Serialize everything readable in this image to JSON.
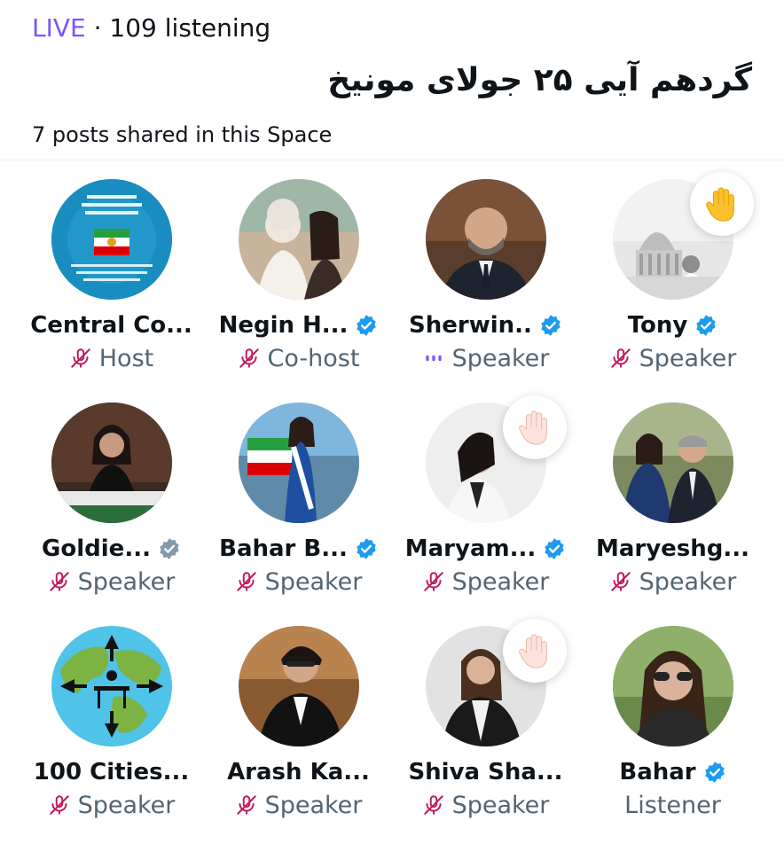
{
  "header": {
    "live_label": "LIVE",
    "separator": "·",
    "listening": "109 listening",
    "title": "گردهم آیی ۲۵ جولای مونیخ",
    "posts_shared": "7 posts shared in this Space"
  },
  "colors": {
    "accent_purple": "#7856ff",
    "muted_pink": "#c2185b",
    "verified_blue": "#1d9bf0",
    "verified_gray": "#829aab",
    "secondary_text": "#536471"
  },
  "participants": [
    {
      "name": "Central Co...",
      "role": "Host",
      "verified": "none",
      "icon": "mic-off-icon"
    },
    {
      "name": "Negin H...",
      "role": "Co-host",
      "verified": "blue",
      "icon": "mic-off-icon"
    },
    {
      "name": "Sherwin..",
      "role": "Speaker",
      "verified": "blue",
      "icon": "speaking-dots-icon"
    },
    {
      "name": "Tony",
      "role": "Speaker",
      "verified": "blue",
      "icon": "mic-off-icon",
      "hand": "raised-hand-yellow"
    },
    {
      "name": "Goldie...",
      "role": "Speaker",
      "verified": "gray",
      "icon": "mic-off-icon"
    },
    {
      "name": "Bahar B...",
      "role": "Speaker",
      "verified": "blue",
      "icon": "mic-off-icon"
    },
    {
      "name": "Maryam...",
      "role": "Speaker",
      "verified": "blue",
      "icon": "mic-off-icon",
      "hand": "raised-hand-light"
    },
    {
      "name": "Maryeshg...",
      "role": "Speaker",
      "verified": "none",
      "icon": "mic-off-icon"
    },
    {
      "name": "100 Cities...",
      "role": "Speaker",
      "verified": "none",
      "icon": "mic-off-icon"
    },
    {
      "name": "Arash Ka...",
      "role": "Speaker",
      "verified": "none",
      "icon": "mic-off-icon"
    },
    {
      "name": "Shiva Sha...",
      "role": "Speaker",
      "verified": "none",
      "icon": "mic-off-icon",
      "hand": "raised-hand-light"
    },
    {
      "name": "Bahar",
      "role": "Listener",
      "verified": "blue",
      "icon": "none"
    }
  ]
}
